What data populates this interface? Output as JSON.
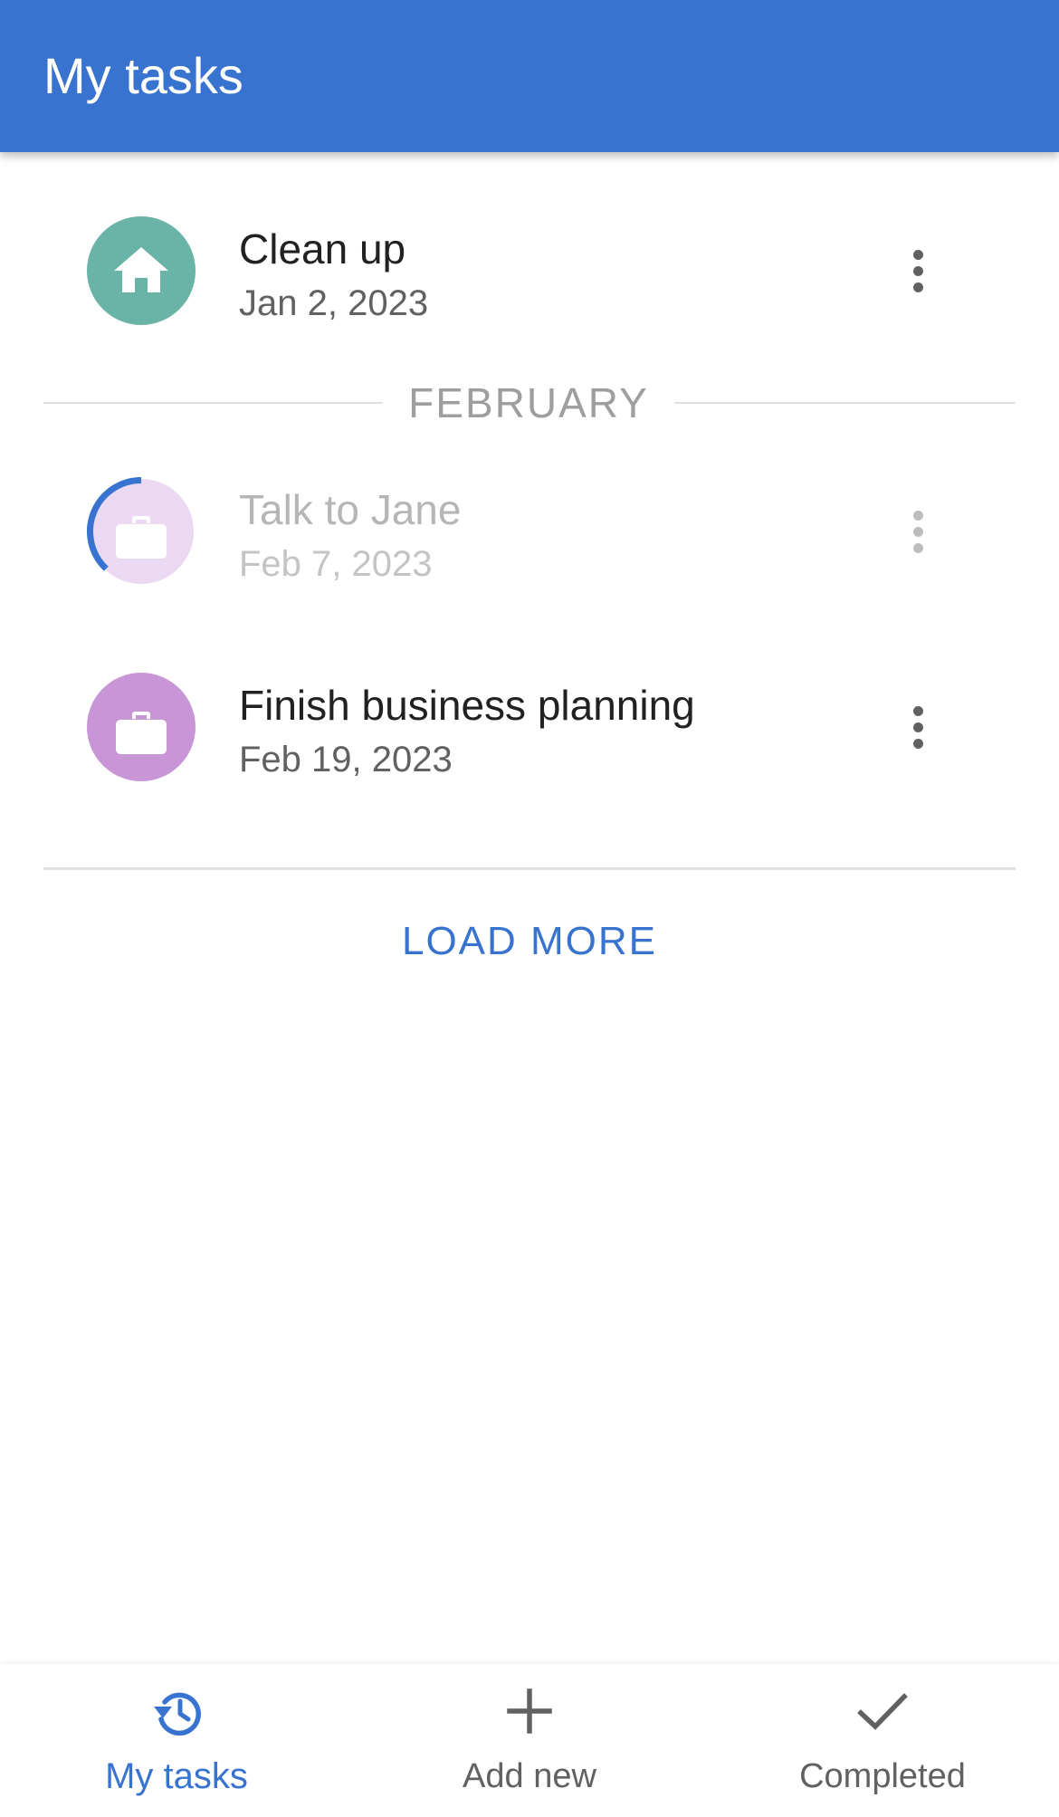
{
  "app_bar": {
    "title": "My tasks"
  },
  "colors": {
    "primary": "#3874cf",
    "home_avatar": "#69b3a7",
    "work_avatar": "#c896d6",
    "work_avatar_faded": "#ebd8f2",
    "text_primary": "#212121",
    "text_secondary": "#616161"
  },
  "tasks_before_divider": [
    {
      "title": "Clean up",
      "date": "Jan 2, 2023",
      "icon": "home-icon",
      "menu_icon": "more-vert-icon"
    }
  ],
  "month_divider": {
    "label": "FEBRUARY"
  },
  "tasks_after_divider": [
    {
      "title": "Talk to Jane",
      "date": "Feb 7, 2023",
      "icon": "briefcase-icon",
      "menu_icon": "more-vert-icon",
      "state": "in progress",
      "progress": 0.38
    },
    {
      "title": "Finish business planning",
      "date": "Feb 19, 2023",
      "icon": "briefcase-icon",
      "menu_icon": "more-vert-icon"
    }
  ],
  "load_more": {
    "label": "LOAD MORE"
  },
  "bottom_nav": {
    "items": [
      {
        "label": "My tasks",
        "icon": "history-icon",
        "active": true
      },
      {
        "label": "Add new",
        "icon": "plus-icon",
        "active": false
      },
      {
        "label": "Completed",
        "icon": "check-icon",
        "active": false
      }
    ]
  }
}
